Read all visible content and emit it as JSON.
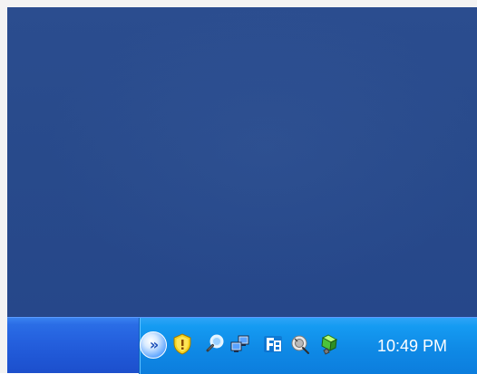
{
  "taskbar": {
    "clock": {
      "time": "10:49 PM"
    },
    "tray": {
      "chevron_glyph": "»",
      "icons": [
        {
          "name": "security-center-icon"
        },
        {
          "name": "search-icon"
        },
        {
          "name": "network-icon"
        },
        {
          "name": "ime-language-icon"
        },
        {
          "name": "volume-icon"
        },
        {
          "name": "safely-remove-hardware-icon"
        }
      ]
    }
  },
  "colors": {
    "desktop": "#284a8b",
    "taskbar": "#245fdd",
    "tray": "#0f8ae6",
    "clock_text": "#ffffff"
  }
}
